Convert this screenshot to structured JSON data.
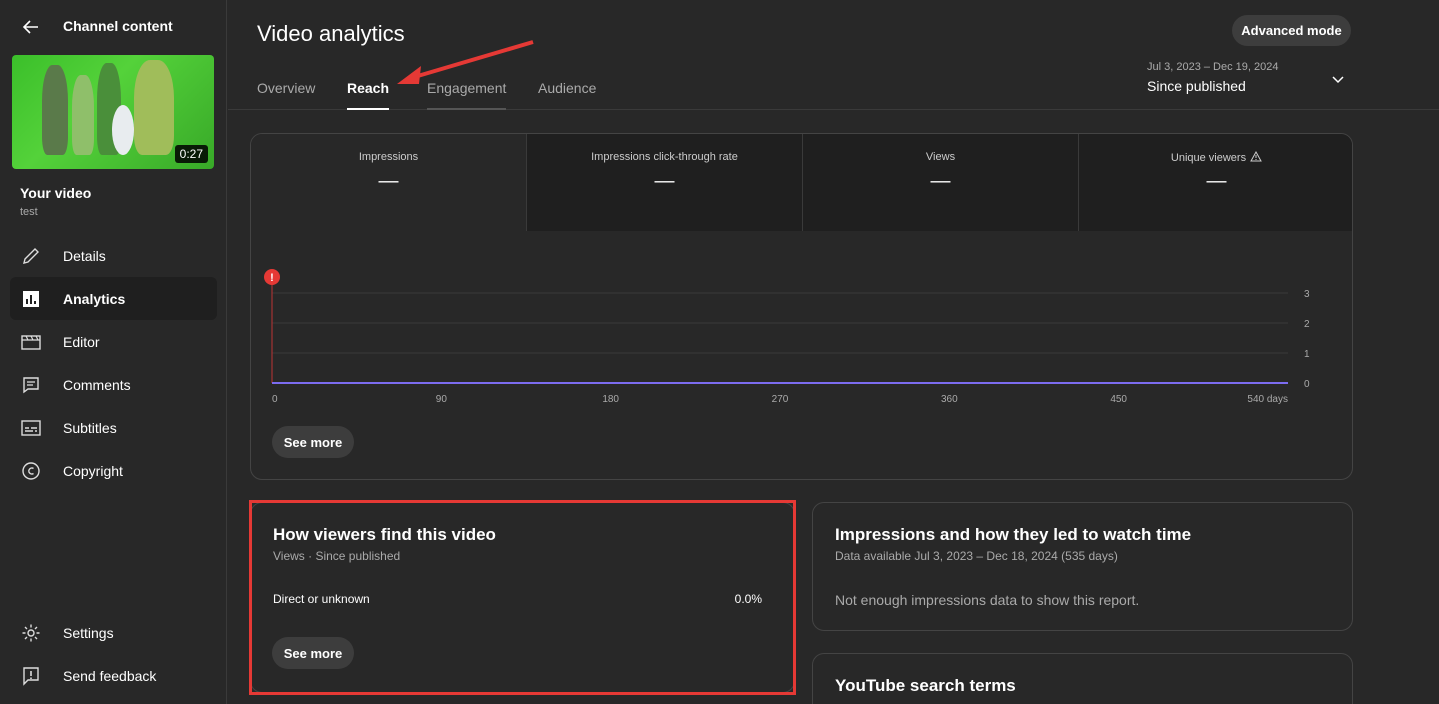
{
  "sidebar": {
    "title": "Channel content",
    "thumbnail_duration": "0:27",
    "video_title": "Your video",
    "video_subtitle": "test",
    "items": [
      {
        "label": "Details",
        "icon": "pencil-icon"
      },
      {
        "label": "Analytics",
        "icon": "analytics-icon",
        "active": true
      },
      {
        "label": "Editor",
        "icon": "editor-icon"
      },
      {
        "label": "Comments",
        "icon": "comments-icon"
      },
      {
        "label": "Subtitles",
        "icon": "subtitles-icon"
      },
      {
        "label": "Copyright",
        "icon": "copyright-icon"
      }
    ],
    "bottom_items": [
      {
        "label": "Settings",
        "icon": "gear-icon"
      },
      {
        "label": "Send feedback",
        "icon": "feedback-icon"
      }
    ]
  },
  "header": {
    "title": "Video analytics",
    "advanced_mode": "Advanced mode",
    "tabs": [
      {
        "label": "Overview"
      },
      {
        "label": "Reach",
        "active": true
      },
      {
        "label": "Engagement"
      },
      {
        "label": "Audience"
      }
    ],
    "date_range": "Jul 3, 2023 – Dec 19, 2024",
    "date_selection": "Since published"
  },
  "metrics": [
    {
      "label": "Impressions",
      "value": "—"
    },
    {
      "label": "Impressions click-through rate",
      "value": "—"
    },
    {
      "label": "Views",
      "value": "—"
    },
    {
      "label": "Unique viewers",
      "value": "—"
    }
  ],
  "chart_data": {
    "type": "line",
    "x_ticks": [
      "0",
      "90",
      "180",
      "270",
      "360",
      "450",
      "540 days"
    ],
    "y_ticks": [
      "3",
      "2",
      "1",
      "0"
    ],
    "xlim": [
      0,
      540
    ],
    "ylim": [
      0,
      3
    ],
    "series": [
      {
        "color": "#7c6cf0",
        "x": [
          0,
          540
        ],
        "values": [
          0,
          0
        ]
      }
    ],
    "annotation_marker": "!",
    "colors": {
      "series": "#7c6cf0",
      "marker": "#e53935",
      "marker_line": "#b33"
    }
  },
  "see_more": "See more",
  "traffic_card": {
    "title": "How viewers find this video",
    "subtitle": "Views · Since published",
    "rows": [
      {
        "label": "Direct or unknown",
        "value": "0.0%"
      }
    ],
    "see_more": "See more"
  },
  "impressions_card": {
    "title": "Impressions and how they led to watch time",
    "subtitle": "Data available Jul 3, 2023 – Dec 18, 2024 (535 days)",
    "message": "Not enough impressions data to show this report."
  },
  "search_card": {
    "title": "YouTube search terms"
  }
}
